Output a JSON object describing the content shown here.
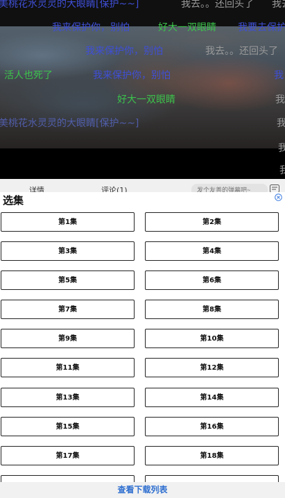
{
  "danmaku": [
    {
      "text": "美桃花水灵灵的大眼睛[保护~~]",
      "color": "blue"
    },
    {
      "text": "我去。。还回头了",
      "color": "gray"
    },
    {
      "text": "我去",
      "color": "gray"
    },
    {
      "text": "我来保护你，别怕",
      "color": "blue"
    },
    {
      "text": "好大一双眼睛",
      "color": "green"
    },
    {
      "text": "我要去保护",
      "color": "blue"
    },
    {
      "text": "我来保护你，别怕",
      "color": "blue"
    },
    {
      "text": "我去。。还回头了",
      "color": "gray"
    },
    {
      "text": "活人也死了",
      "color": "green"
    },
    {
      "text": "我来保护你，别怕",
      "color": "blue"
    },
    {
      "text": "我",
      "color": "blue"
    },
    {
      "text": "好大一双眼睛",
      "color": "green"
    },
    {
      "text": "我",
      "color": "gray"
    },
    {
      "text": "美桃花水灵灵的大眼睛[保护~~]",
      "color": "dim"
    },
    {
      "text": "我",
      "color": "gray"
    },
    {
      "text": "我",
      "color": "gray"
    },
    {
      "text": "我",
      "color": "gray"
    }
  ],
  "tabs": {
    "details": "详情",
    "comments": "评论(1)",
    "comment_placeholder": "发个友善的弹幕吧~"
  },
  "sheet": {
    "title": "选集",
    "episodes": [
      "第1集",
      "第2集",
      "第3集",
      "第4集",
      "第5集",
      "第6集",
      "第7集",
      "第8集",
      "第9集",
      "第10集",
      "第11集",
      "第12集",
      "第13集",
      "第14集",
      "第15集",
      "第16集",
      "第17集",
      "第18集"
    ],
    "download_link": "查看下载列表"
  },
  "colors": {
    "danmaku_blue": "#3f4fd6",
    "danmaku_green": "#3cc24b",
    "danmaku_gray": "#9a9a9a",
    "link_blue": "#2f6fd0"
  }
}
